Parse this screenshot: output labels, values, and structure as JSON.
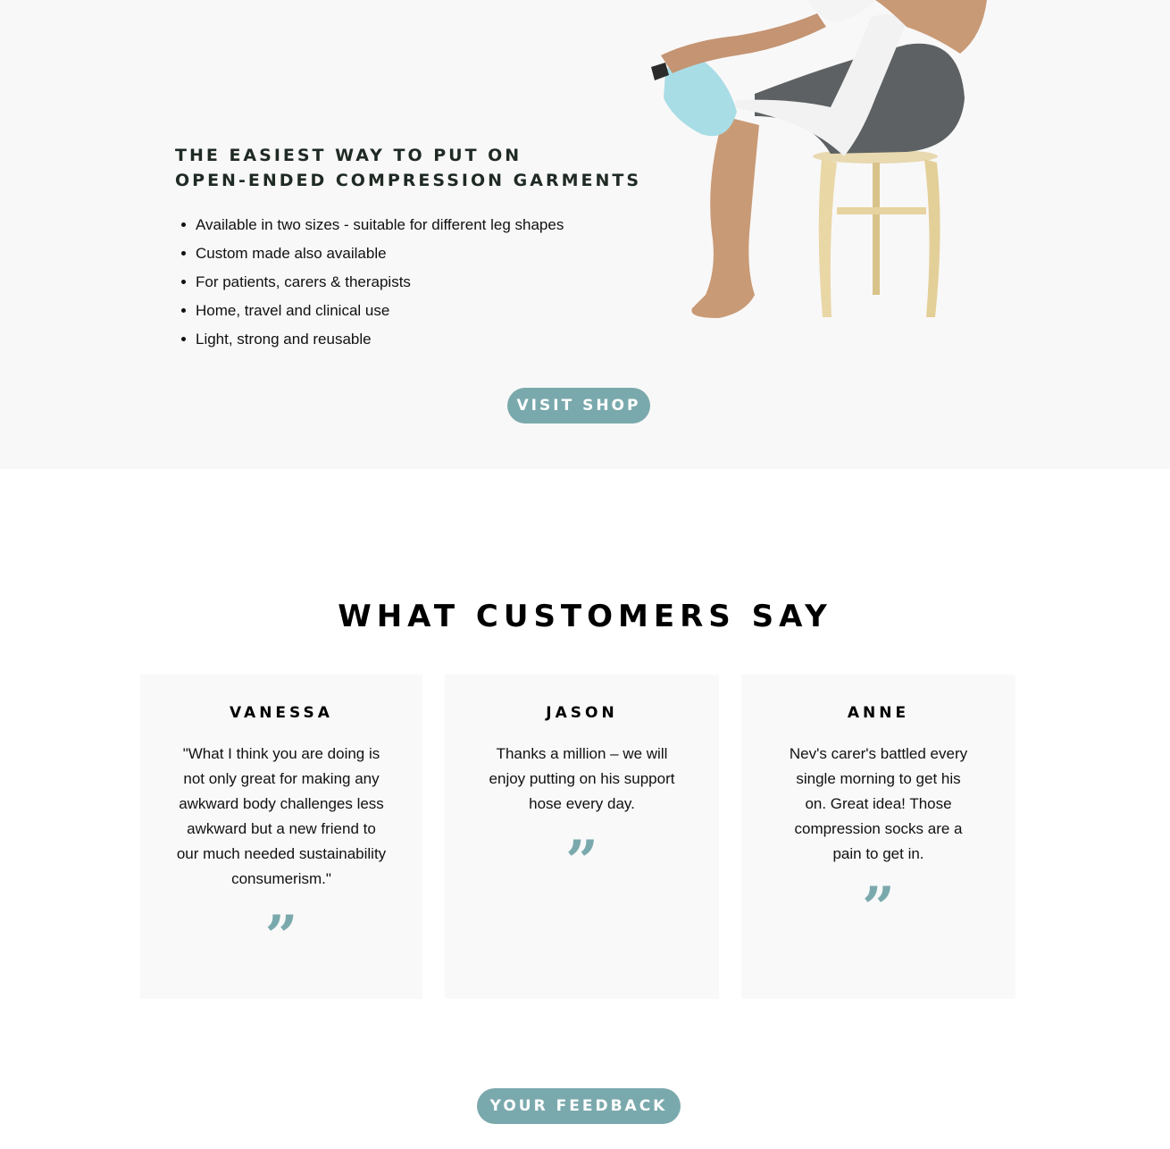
{
  "hero": {
    "heading_line1": "THE EASIEST WAY TO PUT ON",
    "heading_line2": "OPEN-ENDED COMPRESSION GARMENTS",
    "features": [
      "Available in two sizes - suitable for different leg shapes",
      "Custom made also available",
      "For patients, carers & therapists",
      "Home, travel and clinical use",
      "Light, strong and reusable"
    ],
    "visit_shop_label": "VISIT SHOP"
  },
  "testimonials": {
    "title": "WHAT CUSTOMERS SAY",
    "items": [
      {
        "name": "VANESSA",
        "quote": "\"What I think you are doing is not only great for making any awkward body challenges less awkward but a new friend to our much needed sustainability consumerism.\""
      },
      {
        "name": "JASON",
        "quote": "Thanks a million – we will enjoy putting on his support hose every day."
      },
      {
        "name": "ANNE",
        "quote": "Nev's carer's battled every single morning to get his on. Great idea! Those compression socks are a pain to get in."
      }
    ],
    "quote_mark": "”",
    "feedback_label": "YOUR FEEDBACK"
  },
  "colors": {
    "accent": "#7aa9ad",
    "hero_background": "#f9f8f8",
    "card_background": "#f9f9f9",
    "heading": "#1f2a24"
  },
  "icons": {
    "quote": "closing-quote-icon"
  }
}
